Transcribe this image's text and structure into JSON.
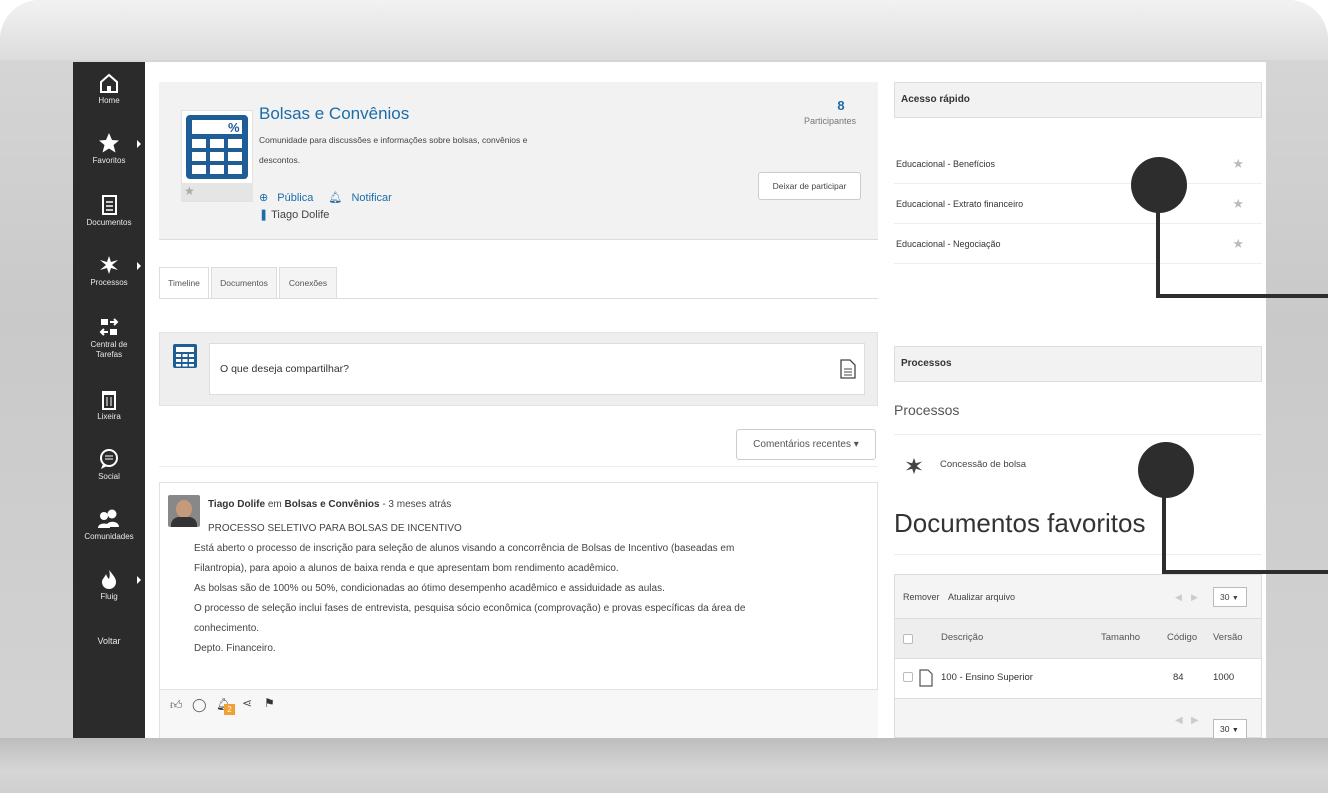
{
  "sidebar": {
    "items": [
      {
        "label": "Home",
        "icon": "home-icon"
      },
      {
        "label": "Favoritos",
        "icon": "star-icon"
      },
      {
        "label": "Documentos",
        "icon": "document-icon"
      },
      {
        "label": "Processos",
        "icon": "process-icon"
      },
      {
        "label": "Central de Tarefas",
        "icon": "tasks-icon"
      },
      {
        "label": "Lixeira",
        "icon": "trash-icon"
      },
      {
        "label": "Social",
        "icon": "chat-icon"
      },
      {
        "label": "Comunidades",
        "icon": "community-icon"
      },
      {
        "label": "Fluig",
        "icon": "fluig-icon"
      },
      {
        "label": "Voltar"
      }
    ]
  },
  "community": {
    "title": "Bolsas e Convênios",
    "description": "Comunidade para discussões e informações sobre bolsas, convênios e descontos.",
    "visibility": "Pública",
    "notify": "Notificar",
    "owner": "Tiago Dolife",
    "participants_count": "8",
    "participants_label": "Participantes",
    "leave_button": "Deixar de participar"
  },
  "tabs": [
    "Timeline",
    "Documentos",
    "Conexões"
  ],
  "share": {
    "placeholder": "O que deseja compartilhar?"
  },
  "recent_button": "Comentários recentes",
  "post": {
    "author": "Tiago Dolife",
    "connector": "em",
    "community": "Bolsas e Convênios",
    "time": "- 3 meses atrás",
    "lines": [
      "PROCESSO SELETIVO PARA BOLSAS DE INCENTIVO",
      "Está aberto o processo de inscrição para seleção de alunos visando a concorrência de Bolsas de Incentivo (baseadas em",
      "Filantropia), para apoio a alunos de baixa renda e que apresentam bom rendimento acadêmico.",
      "As bolsas são de 100% ou 50%, condicionadas ao ótimo desempenho acadêmico e assiduidade as aulas.",
      "O processo de seleção inclui fases de entrevista, pesquisa sócio econômica (comprovação) e provas específicas da área de",
      "conhecimento.",
      "Depto. Financeiro."
    ],
    "notification_count": "2"
  },
  "quick_access": {
    "title": "Acesso rápido",
    "items": [
      "Educacional - Benefícios",
      "Educacional - Extrato financeiro",
      "Educacional - Negociação"
    ]
  },
  "processes": {
    "panel_title": "Processos",
    "title": "Processos",
    "item": "Concessão de bolsa"
  },
  "documents": {
    "title": "Documentos favoritos",
    "toolbar": {
      "remove": "Remover",
      "update": "Atualizar arquivo",
      "page_size": "30"
    },
    "columns": [
      "Descrição",
      "Tamanho",
      "Código",
      "Versão"
    ],
    "rows": [
      {
        "description": "100 - Ensino Superior",
        "size": "",
        "code": "84",
        "version": "1000"
      }
    ],
    "footer_page_size": "30"
  },
  "colors": {
    "sidebar": "#2b2b2b",
    "link": "#1b6ca8",
    "icon_blue": "#1f5d97",
    "badge": "#f0a030"
  }
}
